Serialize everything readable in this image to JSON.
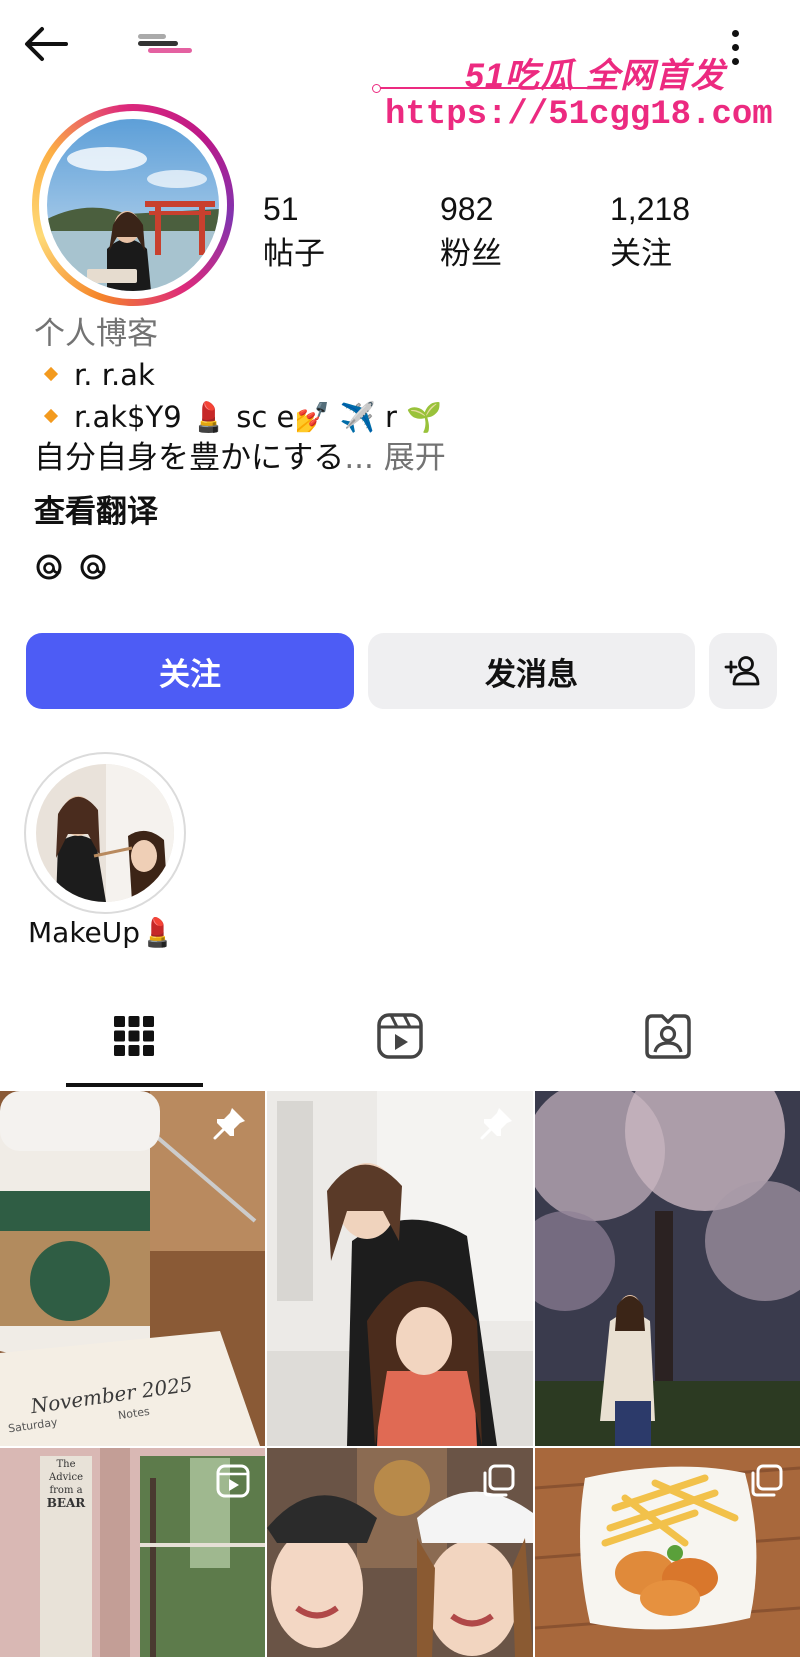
{
  "header": {
    "back_icon": "arrow-left-icon",
    "more_icon": "more-vertical-icon"
  },
  "watermark": {
    "title": "51吃瓜 全网首发",
    "url": "https://51cgg18.com"
  },
  "profile": {
    "stats": [
      {
        "value": "51",
        "label": "帖子"
      },
      {
        "value": "982",
        "label": "粉丝"
      },
      {
        "value": "1,218",
        "label": "关注"
      }
    ],
    "category": "个人博客",
    "bio_lines": [
      "r. r.ak",
      "r.ak$Y9 💄 sc          e💅          ✈️ r          🌱"
    ],
    "bio_text": "自分自身を豊かにする",
    "bio_more": "... 展开",
    "translate": "查看翻译"
  },
  "actions": {
    "follow": "关注",
    "message": "发消息",
    "add_person_icon": "add-person-icon"
  },
  "highlights": [
    {
      "label": "MakeUp💄"
    }
  ],
  "tabs": [
    {
      "name": "grid",
      "icon": "grid-icon",
      "active": true
    },
    {
      "name": "reels",
      "icon": "reels-icon",
      "active": false
    },
    {
      "name": "tagged",
      "icon": "tagged-user-icon",
      "active": false
    }
  ],
  "posts": [
    {
      "icon": "pin-icon"
    },
    {
      "icon": "pin-icon"
    },
    {
      "icon": ""
    },
    {
      "icon": "reel-icon"
    },
    {
      "icon": "carousel-icon"
    },
    {
      "icon": "carousel-icon"
    }
  ],
  "post_texts": {
    "calendar_month": "November 2025",
    "calendar_day": "Saturday",
    "calendar_notes": "Notes",
    "poster_line1": "The",
    "poster_line2": "Advice",
    "poster_line3": "from a",
    "poster_line4": "BEAR"
  },
  "colors": {
    "follow_button": "#4d5cf5",
    "secondary_button": "#efeff1",
    "muted_text": "#737373",
    "watermark": "#ec2a80"
  }
}
